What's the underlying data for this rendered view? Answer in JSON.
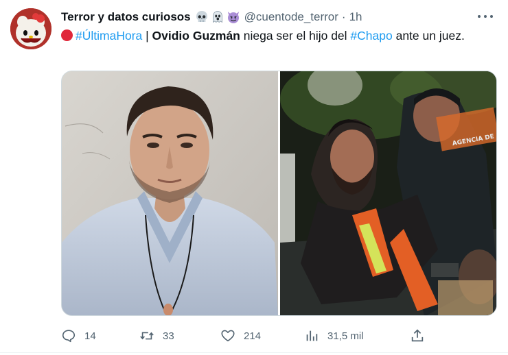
{
  "author": {
    "display_name": "Terror y datos curiosos",
    "emojis": [
      "skull-icon",
      "ghost-icon",
      "smiling-devil-icon"
    ],
    "handle": "@cuentode_terror",
    "separator": "·",
    "time": "1h"
  },
  "tweet": {
    "hashtag_breaking": "#ÚltimaHora",
    "pipe": " | ",
    "name_bold": "Ovidio Guzmán",
    "text_middle": " niega ser el hijo del ",
    "hashtag_chapo": "#Chapo",
    "text_end": " ante un juez."
  },
  "media": {
    "images": [
      "mugshot-photo",
      "arrest-photo"
    ],
    "vest_text": "AGENCIA DE INVESTIGACIÓN CRIMINAL"
  },
  "actions": {
    "replies": "14",
    "retweets": "33",
    "likes": "214",
    "views": "31,5 mil"
  },
  "colors": {
    "link": "#1d9bf0",
    "muted": "#536471",
    "text": "#0f1419",
    "breaking_dot": "#e0283b"
  }
}
